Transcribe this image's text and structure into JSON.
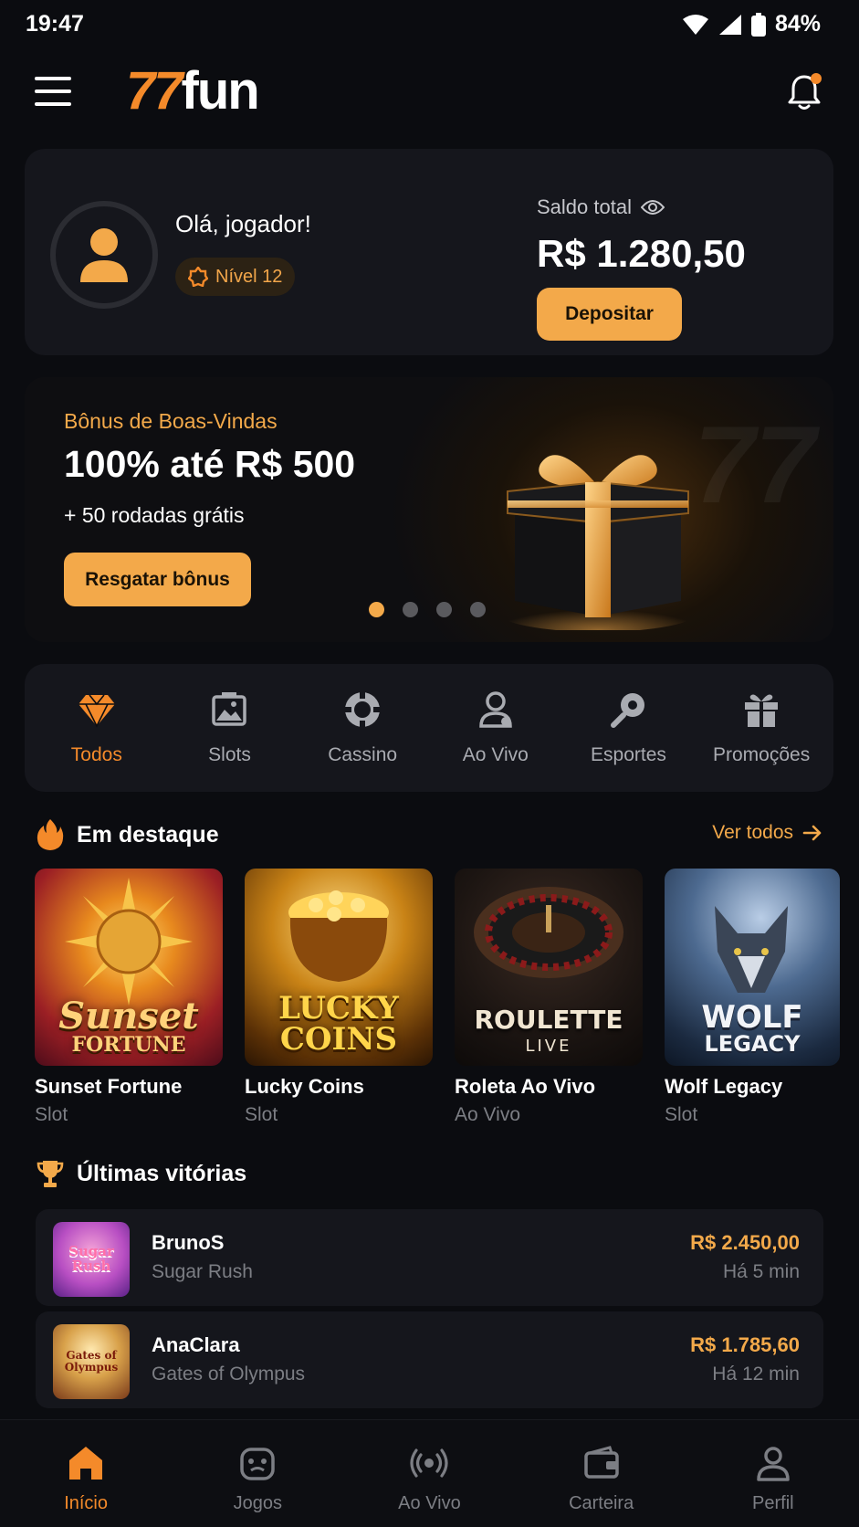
{
  "status_bar": {
    "time": "19:47",
    "battery": "84%"
  },
  "header": {
    "logo_num": "77",
    "logo_text": "fun"
  },
  "profile": {
    "greeting": "Olá, jogador!",
    "level": "Nível 12",
    "balance_label": "Saldo total",
    "balance_value": "R$ 1.280,50",
    "deposit_label": "Depositar"
  },
  "banner": {
    "subtitle": "Bônus de Boas-Vindas",
    "title": "100% até R$ 500",
    "description": "+ 50 rodadas grátis",
    "button_label": "Resgatar bônus",
    "watermark": "77",
    "slides_total": 4,
    "active_slide": 1
  },
  "categories": [
    {
      "label": "Todos",
      "icon": "diamond-icon",
      "active": true
    },
    {
      "label": "Slots",
      "icon": "image-icon",
      "active": false
    },
    {
      "label": "Cassino",
      "icon": "chip-icon",
      "active": false
    },
    {
      "label": "Ao Vivo",
      "icon": "live-dealer-icon",
      "active": false
    },
    {
      "label": "Esportes",
      "icon": "sports-icon",
      "active": false
    },
    {
      "label": "Promoções",
      "icon": "gift-icon",
      "active": false
    }
  ],
  "featured": {
    "title": "Em destaque",
    "see_all": "Ver todos",
    "games": [
      {
        "name": "Sunset Fortune",
        "type": "Slot",
        "art_line1": "Sunset",
        "art_line2": "FORTUNE"
      },
      {
        "name": "Lucky Coins",
        "type": "Slot",
        "art_line1": "LUCKY",
        "art_line2": "COINS"
      },
      {
        "name": "Roleta Ao Vivo",
        "type": "Ao Vivo",
        "art_line1": "ROULETTE",
        "art_line2": "LIVE"
      },
      {
        "name": "Wolf Legacy",
        "type": "Slot",
        "art_line1": "WOLF",
        "art_line2": "LEGACY"
      }
    ]
  },
  "recent_wins": {
    "title": "Últimas vitórias",
    "items": [
      {
        "user": "BrunoS",
        "game": "Sugar Rush",
        "amount": "R$ 2.450,00",
        "time": "Há 5 min",
        "art": "Sugar Rush"
      },
      {
        "user": "AnaClara",
        "game": "Gates of Olympus",
        "amount": "R$ 1.785,60",
        "time": "Há 12 min",
        "art": "Gates of Olympus"
      }
    ]
  },
  "bottom_nav": [
    {
      "label": "Início",
      "icon": "home-icon",
      "active": true
    },
    {
      "label": "Jogos",
      "icon": "games-icon",
      "active": false
    },
    {
      "label": "Ao Vivo",
      "icon": "broadcast-icon",
      "active": false
    },
    {
      "label": "Carteira",
      "icon": "wallet-icon",
      "active": false
    },
    {
      "label": "Perfil",
      "icon": "profile-icon",
      "active": false
    }
  ],
  "colors": {
    "accent": "#f3a94a",
    "brand_orange": "#f48a2a",
    "background": "#0b0c10",
    "card": "#15161c"
  }
}
